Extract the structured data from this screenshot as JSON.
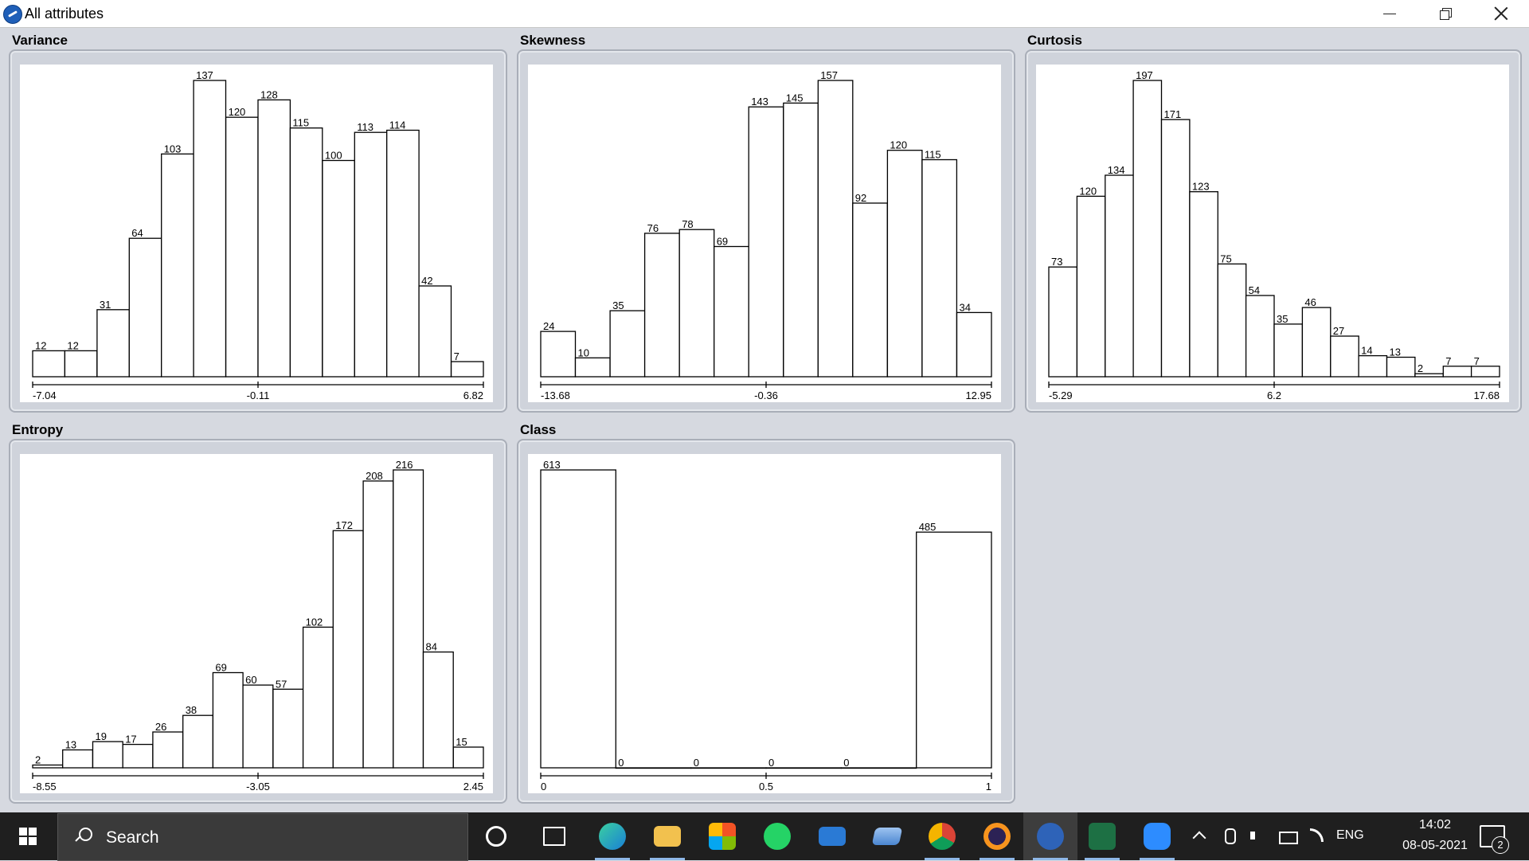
{
  "window": {
    "title": "All attributes"
  },
  "colors": {
    "bar_fill": "#ffffff",
    "bar_stroke": "#000000",
    "panel_bg": "#cfd3db",
    "plot_bg": "#ffffff",
    "taskbar": "#1f1f1f"
  },
  "taskbar": {
    "search_placeholder": "Search",
    "apps": [
      "cortana-icon",
      "task-view-icon",
      "edge-icon",
      "file-explorer-icon",
      "store-icon",
      "whatsapp-icon",
      "mail-icon",
      "laptop-icon",
      "chrome-icon",
      "eclipse-icon",
      "weka-icon",
      "excel-icon",
      "zoom-icon"
    ],
    "language": "ENG",
    "time": "14:02",
    "date": "08-05-2021",
    "notification_count": "2"
  },
  "chart_data": [
    {
      "type": "bar",
      "title": "Variance",
      "values": [
        12,
        12,
        31,
        64,
        103,
        137,
        120,
        128,
        115,
        100,
        113,
        114,
        42,
        7
      ],
      "x_ticks": [
        "-7.04",
        "-0.11",
        "6.82"
      ]
    },
    {
      "type": "bar",
      "title": "Skewness",
      "values": [
        24,
        10,
        35,
        76,
        78,
        69,
        143,
        145,
        157,
        92,
        120,
        115,
        34
      ],
      "x_ticks": [
        "-13.68",
        "-0.36",
        "12.95"
      ]
    },
    {
      "type": "bar",
      "title": "Curtosis",
      "values": [
        73,
        120,
        134,
        197,
        171,
        123,
        75,
        54,
        35,
        46,
        27,
        14,
        13,
        2,
        7,
        7
      ],
      "x_ticks": [
        "-5.29",
        "6.2",
        "17.68"
      ]
    },
    {
      "type": "bar",
      "title": "Entropy",
      "values": [
        2,
        13,
        19,
        17,
        26,
        38,
        69,
        60,
        57,
        102,
        172,
        208,
        216,
        84,
        15
      ],
      "x_ticks": [
        "-8.55",
        "-3.05",
        "2.45"
      ]
    },
    {
      "type": "bar",
      "title": "Class",
      "values": [
        613,
        0,
        0,
        0,
        0,
        485
      ],
      "x_ticks": [
        "0",
        "0.5",
        "1"
      ]
    }
  ]
}
